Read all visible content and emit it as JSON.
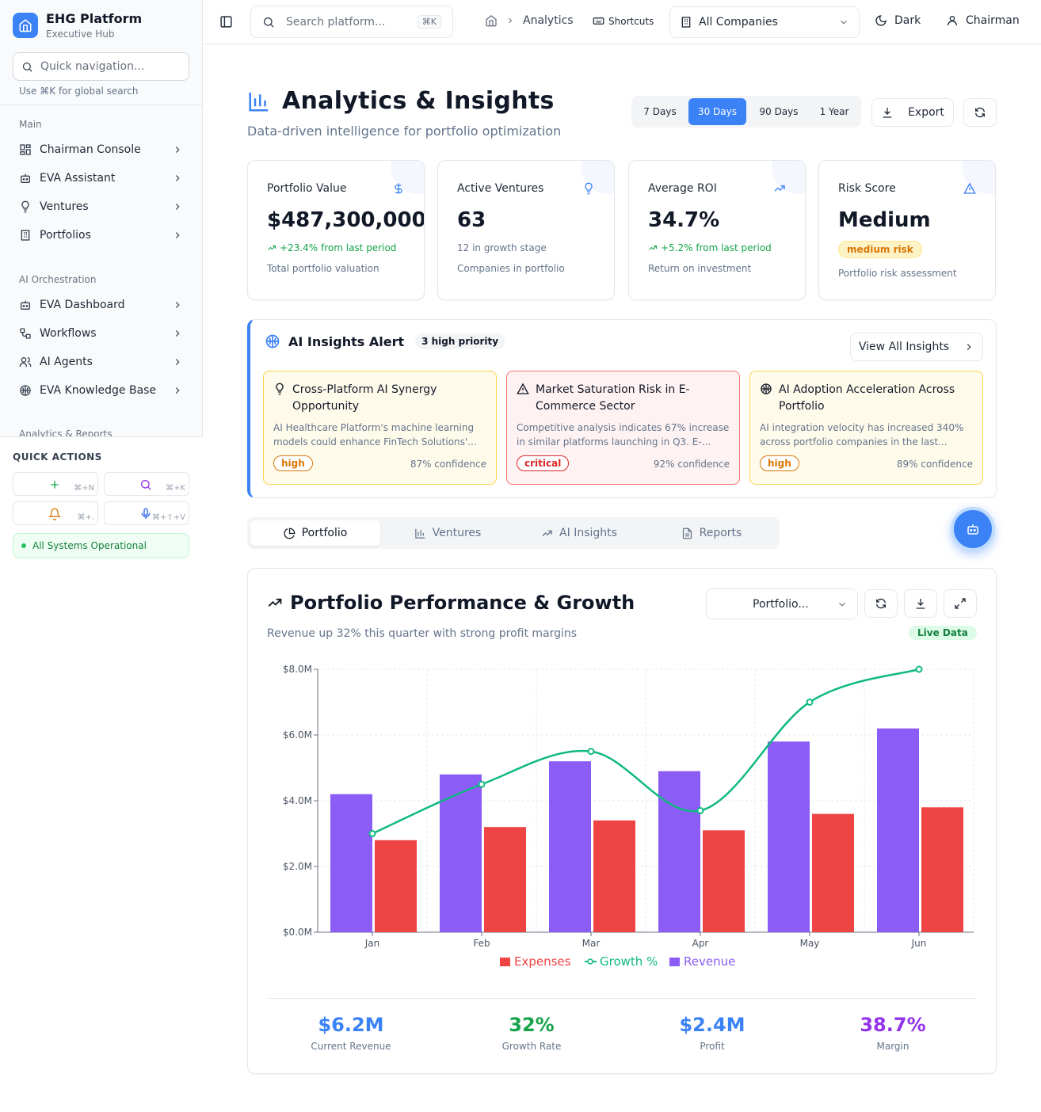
{
  "brand": {
    "title": "EHG Platform",
    "subtitle": "Executive Hub"
  },
  "sidebar": {
    "quick_nav_placeholder": "Quick navigation...",
    "quick_nav_hint": "Use ⌘K for global search",
    "groups": [
      {
        "label": "Main",
        "items": [
          {
            "label": "Chairman Console",
            "icon": "dashboard-icon"
          },
          {
            "label": "EVA Assistant",
            "icon": "bot-icon"
          },
          {
            "label": "Ventures",
            "icon": "lightbulb-icon"
          },
          {
            "label": "Portfolios",
            "icon": "building-icon"
          }
        ]
      },
      {
        "label": "AI Orchestration",
        "items": [
          {
            "label": "EVA Dashboard",
            "icon": "bot-icon"
          },
          {
            "label": "Workflows",
            "icon": "workflow-icon"
          },
          {
            "label": "AI Agents",
            "icon": "users-icon"
          },
          {
            "label": "EVA Knowledge Base",
            "icon": "brain-icon"
          }
        ]
      },
      {
        "label": "Analytics & Reports",
        "items": []
      }
    ],
    "quick_actions": {
      "title": "QUICK ACTIONS",
      "buttons": [
        {
          "icon": "plus-icon",
          "shortcut": "⌘+N",
          "color": "#16a34a"
        },
        {
          "icon": "search-icon",
          "shortcut": "⌘+K",
          "color": "#9333ea"
        },
        {
          "icon": "bell-icon",
          "shortcut": "⌘+.",
          "color": "#d97706"
        },
        {
          "icon": "mic-icon",
          "shortcut": "⌘+⇧+V",
          "color": "#2563eb"
        }
      ]
    },
    "status": "All Systems Operational"
  },
  "topbar": {
    "search_placeholder": "Search platform...",
    "search_kbd": "⌘K",
    "breadcrumb": "Analytics",
    "shortcuts_label": "Shortcuts",
    "company_select": "All Companies",
    "theme_label": "Dark",
    "user_label": "Chairman"
  },
  "header": {
    "title": "Analytics & Insights",
    "subtitle": "Data-driven intelligence for portfolio optimization",
    "ranges": [
      "7 Days",
      "30 Days",
      "90 Days",
      "1 Year"
    ],
    "active_range": "30 Days",
    "export_label": "Export"
  },
  "kpis": [
    {
      "label": "Portfolio Value",
      "icon": "dollar-icon",
      "value": "$487,300,000",
      "change": "+23.4% from last period",
      "desc": "Total portfolio valuation"
    },
    {
      "label": "Active Ventures",
      "icon": "lightbulb-icon",
      "value": "63",
      "note": "12 in growth stage",
      "desc": "Companies in portfolio"
    },
    {
      "label": "Average ROI",
      "icon": "trending-up-icon",
      "value": "34.7%",
      "change": "+5.2% from last period",
      "desc": "Return on investment"
    },
    {
      "label": "Risk Score",
      "icon": "alert-triangle-icon",
      "value": "Medium",
      "badge": "medium risk",
      "desc": "Portfolio risk assessment"
    }
  ],
  "ai_insights": {
    "title": "AI Insights Alert",
    "badge": "3 high priority",
    "view_all": "View All Insights",
    "cards": [
      {
        "title": "Cross-Platform AI Synergy Opportunity",
        "body": "AI Healthcare Platform's machine learning models could enhance FinTech Solutions'...",
        "tag": "high",
        "confidence": "87% confidence",
        "bg": "#fffbeb",
        "border": "#fcd34d",
        "tag_color": "#d97706",
        "icon": "lightbulb-icon"
      },
      {
        "title": "Market Saturation Risk in E-Commerce Sector",
        "body": "Competitive analysis indicates 67% increase in similar platforms launching in Q3. E-...",
        "tag": "critical",
        "confidence": "92% confidence",
        "bg": "#fef2f2",
        "border": "#f87171",
        "tag_color": "#dc2626",
        "icon": "alert-triangle-icon"
      },
      {
        "title": "AI Adoption Acceleration Across Portfolio",
        "body": "AI integration velocity has increased 340% across portfolio companies in the last...",
        "tag": "high",
        "confidence": "89% confidence",
        "bg": "#fffbeb",
        "border": "#fcd34d",
        "tag_color": "#d97706",
        "icon": "brain-icon"
      }
    ]
  },
  "tabs": [
    {
      "label": "Portfolio",
      "icon": "pie-chart-icon",
      "active": true
    },
    {
      "label": "Ventures",
      "icon": "bar-chart-icon",
      "active": false
    },
    {
      "label": "AI Insights",
      "icon": "trending-up-icon",
      "active": false
    },
    {
      "label": "Reports",
      "icon": "file-icon",
      "active": false
    }
  ],
  "chart_card": {
    "title": "Portfolio Performance & Growth",
    "subtitle": "Revenue up 32% this quarter with strong profit margins",
    "select_value": "Portfolio...",
    "live_badge": "Live Data"
  },
  "chart_data": {
    "type": "bar",
    "categories": [
      "Jan",
      "Feb",
      "Mar",
      "Apr",
      "May",
      "Jun"
    ],
    "series": [
      {
        "name": "Revenue",
        "type": "bar",
        "color": "#8b5cf6",
        "values": [
          4.2,
          4.8,
          5.2,
          4.9,
          5.8,
          6.2
        ]
      },
      {
        "name": "Expenses",
        "type": "bar",
        "color": "#ef4444",
        "values": [
          2.8,
          3.2,
          3.4,
          3.1,
          3.6,
          3.8
        ]
      },
      {
        "name": "Growth %",
        "type": "line",
        "color": "#10b981",
        "values": [
          3.0,
          4.5,
          5.5,
          3.7,
          7.0,
          8.0
        ]
      }
    ],
    "y_ticks": [
      "$0.0M",
      "$2.0M",
      "$4.0M",
      "$6.0M",
      "$8.0M"
    ],
    "ylim": [
      0,
      8
    ],
    "grid": true,
    "legend": [
      "Expenses",
      "Growth %",
      "Revenue"
    ],
    "legend_position": "bottom"
  },
  "summary": [
    {
      "value": "$6.2M",
      "label": "Current Revenue",
      "color": "#3b82f6"
    },
    {
      "value": "32%",
      "label": "Growth Rate",
      "color": "#16a34a"
    },
    {
      "value": "$2.4M",
      "label": "Profit",
      "color": "#3b82f6"
    },
    {
      "value": "38.7%",
      "label": "Margin",
      "color": "#9333ea"
    }
  ]
}
